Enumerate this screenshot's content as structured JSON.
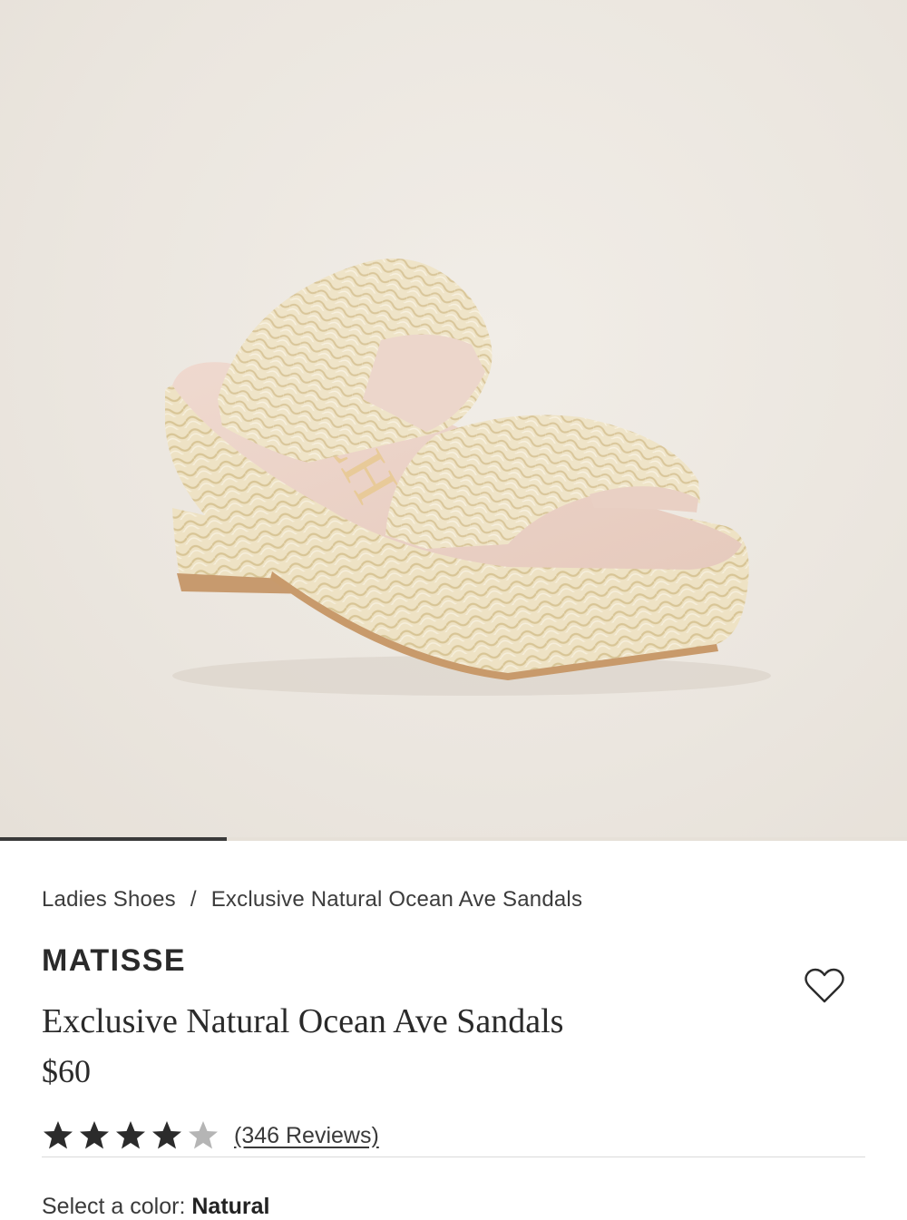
{
  "product_image": {
    "alt": "Exclusive Natural Ocean Ave Sandals",
    "carousel_progress": 0.25,
    "insole_mark": "CH"
  },
  "breadcrumb": {
    "category": "Ladies Shoes",
    "separator": "/",
    "current": "Exclusive Natural Ocean Ave Sandals"
  },
  "product": {
    "brand": "MATISSE",
    "name": "Exclusive Natural Ocean Ave Sandals",
    "price": "$60"
  },
  "rating": {
    "value": 4,
    "max": 5,
    "reviews_label": "(346 Reviews)"
  },
  "color": {
    "label": "Select a color:",
    "selected": "Natural"
  },
  "icons": {
    "wishlist": "heart-outline-icon",
    "star_filled": "star-filled-icon",
    "star_empty": "star-empty-icon"
  },
  "colors": {
    "star_filled": "#2b2b2b",
    "star_empty": "#b5b5b5",
    "carousel_active": "#3a3a3a"
  }
}
